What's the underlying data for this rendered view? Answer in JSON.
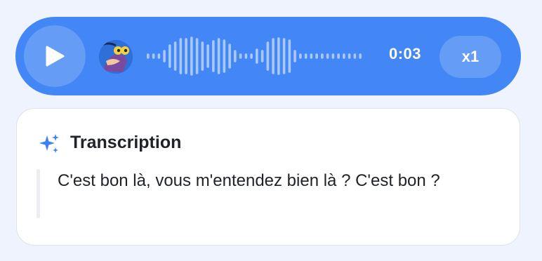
{
  "player": {
    "duration": "0:03",
    "speed": "x1",
    "accent_color": "#4287f5",
    "play_icon": "play-icon",
    "avatar": "user-avatar"
  },
  "transcription": {
    "title": "Transcription",
    "icon": "sparkle-icon",
    "text": "C'est bon là, vous m'entendez bien là ? C'est bon ?"
  }
}
